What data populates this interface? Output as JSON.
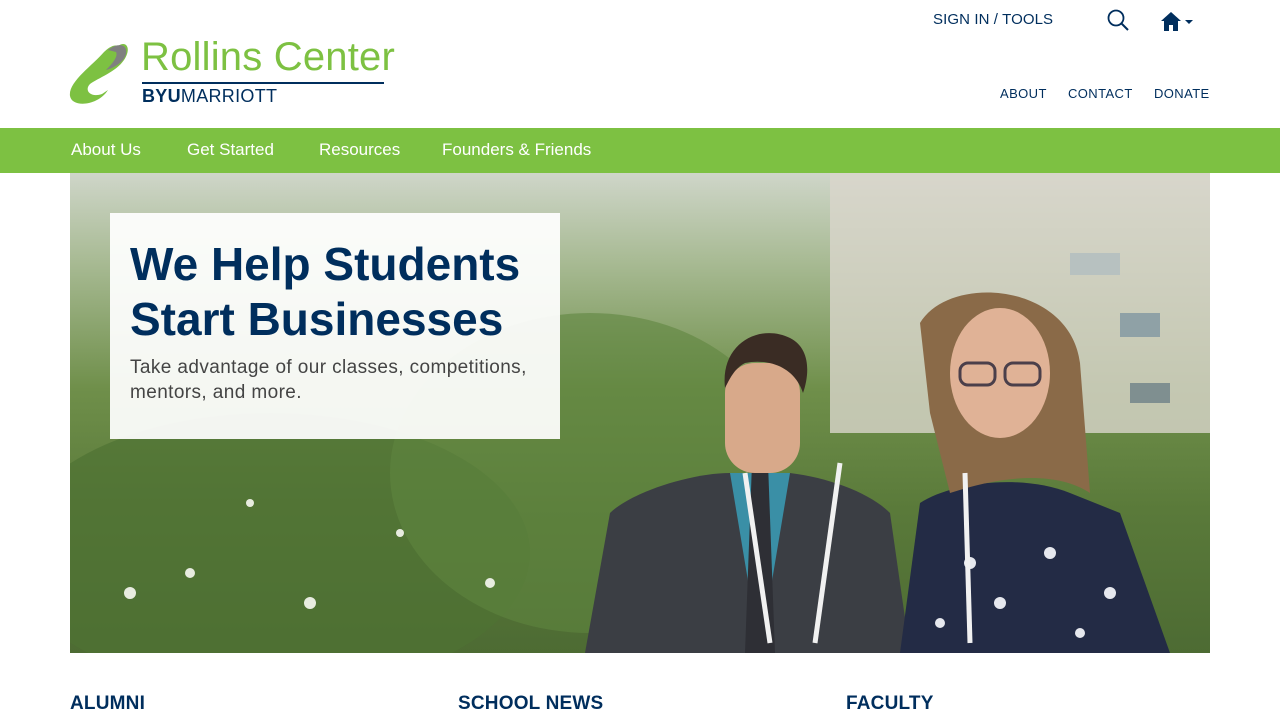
{
  "header": {
    "sign_in": "SIGN IN / TOOLS",
    "search_icon": "search-icon",
    "home_icon": "home-icon"
  },
  "logo": {
    "title": "Rollins Center",
    "sub_bold": "BYU",
    "sub_light": "MARRIOTT"
  },
  "util_nav": {
    "about": "ABOUT",
    "contact": "CONTACT",
    "donate": "DONATE"
  },
  "main_nav": {
    "items": [
      {
        "label": "About Us"
      },
      {
        "label": "Get Started"
      },
      {
        "label": "Resources"
      },
      {
        "label": "Founders & Friends"
      }
    ]
  },
  "hero": {
    "headline": "We Help Students Start Businesses",
    "subtext": "Take advantage of our classes, competitions, mentors, and more."
  },
  "sections": {
    "alumni": "ALUMNI",
    "school_news": "SCHOOL NEWS",
    "faculty": "FACULTY"
  },
  "colors": {
    "brand_green": "#7dc142",
    "brand_navy": "#002e5d"
  }
}
